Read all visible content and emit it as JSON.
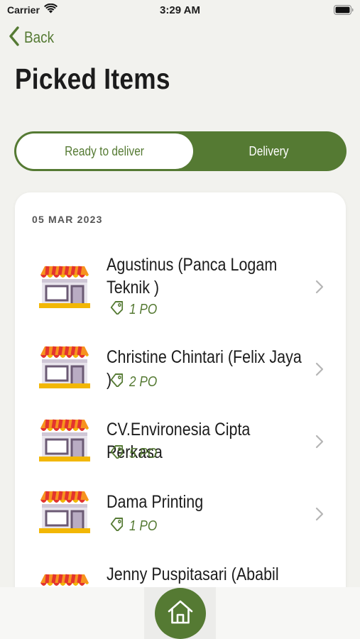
{
  "status_bar": {
    "carrier": "Carrier",
    "time": "3:29 AM"
  },
  "nav": {
    "back_label": "Back"
  },
  "page": {
    "title": "Picked Items"
  },
  "tabs": [
    {
      "label": "Ready to deliver",
      "active": true
    },
    {
      "label": "Delivery",
      "active": false
    }
  ],
  "list": {
    "date": "05 MAR 2023",
    "items": [
      {
        "name": "Agustinus (Panca Logam Teknik )",
        "po": "1 PO"
      },
      {
        "name": "Christine Chintari (Felix Jaya )",
        "po": "2 PO"
      },
      {
        "name": "CV.Environesia Cipta Perkasa",
        "po": "5 PO"
      },
      {
        "name": "Dama Printing",
        "po": "1 PO"
      },
      {
        "name": "Jenny Puspitasari (Ababil",
        "po": ""
      }
    ]
  },
  "colors": {
    "accent": "#557a33",
    "background": "#f2f2ee",
    "card": "#ffffff"
  },
  "icons": [
    "wifi-icon",
    "battery-icon",
    "chevron-left-icon",
    "store-icon",
    "tag-icon",
    "chevron-right-icon",
    "home-icon"
  ]
}
